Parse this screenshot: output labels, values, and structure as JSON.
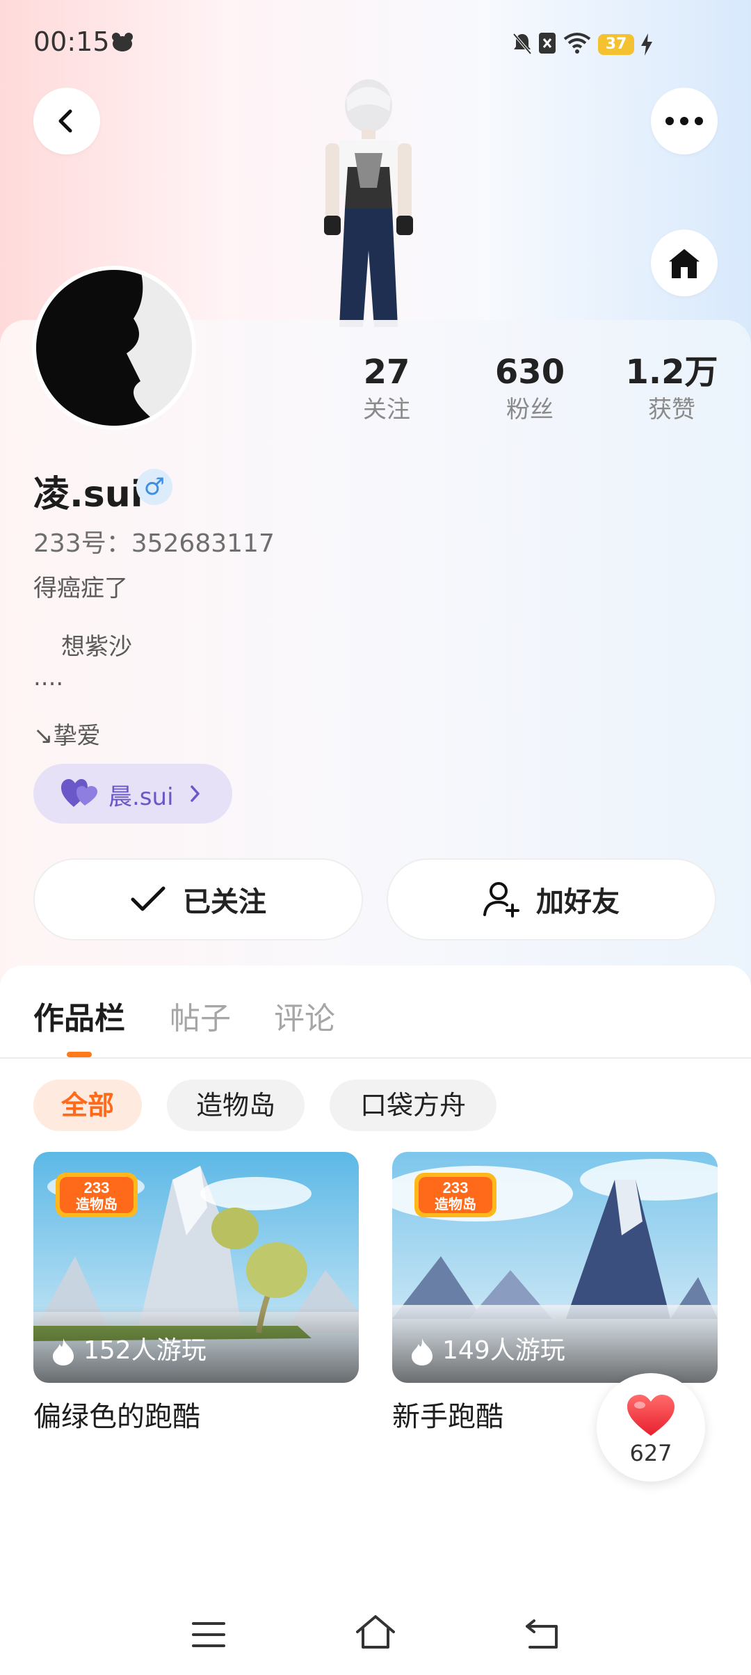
{
  "status_bar": {
    "time": "00:15",
    "battery": "37"
  },
  "profile": {
    "username": "凌.sui",
    "gender_symbol": "♂",
    "uid": "233号：352683117",
    "bio_lines": [
      "得癌症了",
      "想紫沙",
      "....",
      "↘挚爱"
    ],
    "partner": "晨.sui"
  },
  "stats": [
    {
      "value": "27",
      "label": "关注"
    },
    {
      "value": "630",
      "label": "粉丝"
    },
    {
      "value": "1.2万",
      "label": "获赞"
    }
  ],
  "actions": {
    "follow_label": "已关注",
    "add_friend_label": "加好友"
  },
  "tabs": [
    {
      "label": "作品栏"
    },
    {
      "label": "帖子"
    },
    {
      "label": "评论"
    }
  ],
  "filters": [
    {
      "label": "全部"
    },
    {
      "label": "造物岛"
    },
    {
      "label": "口袋方舟"
    }
  ],
  "games": [
    {
      "title": "偏绿色的跑酷",
      "plays": "152人游玩"
    },
    {
      "title": "新手跑酷",
      "plays": "149人游玩"
    }
  ],
  "like_fab": {
    "count": "627"
  },
  "colors": {
    "accent": "#ff7a1a",
    "partner_bg": "#e7e1f8",
    "partner_text": "#6a58c9",
    "gender_bg": "#dcecfb",
    "like_red": "#f23a4a"
  }
}
